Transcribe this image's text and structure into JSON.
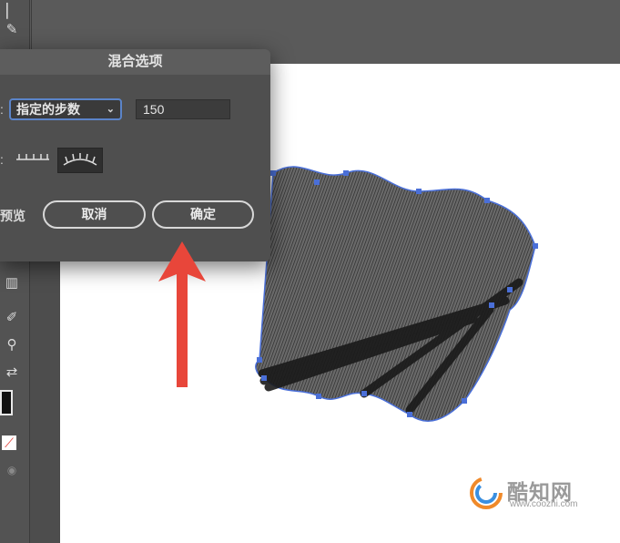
{
  "dialog": {
    "title": "混合选项",
    "spacing_select_value": "指定的步数",
    "steps_value": "150",
    "colon": ":",
    "preview_label": "预览",
    "cancel_label": "取消",
    "ok_label": "确定"
  },
  "watermark": {
    "brand": "酷知网",
    "url": "www.coozhi.com"
  },
  "colors": {
    "arrow": "#e8463a",
    "anchor": "#4a6fd8",
    "accent_border": "#5b84c9"
  }
}
